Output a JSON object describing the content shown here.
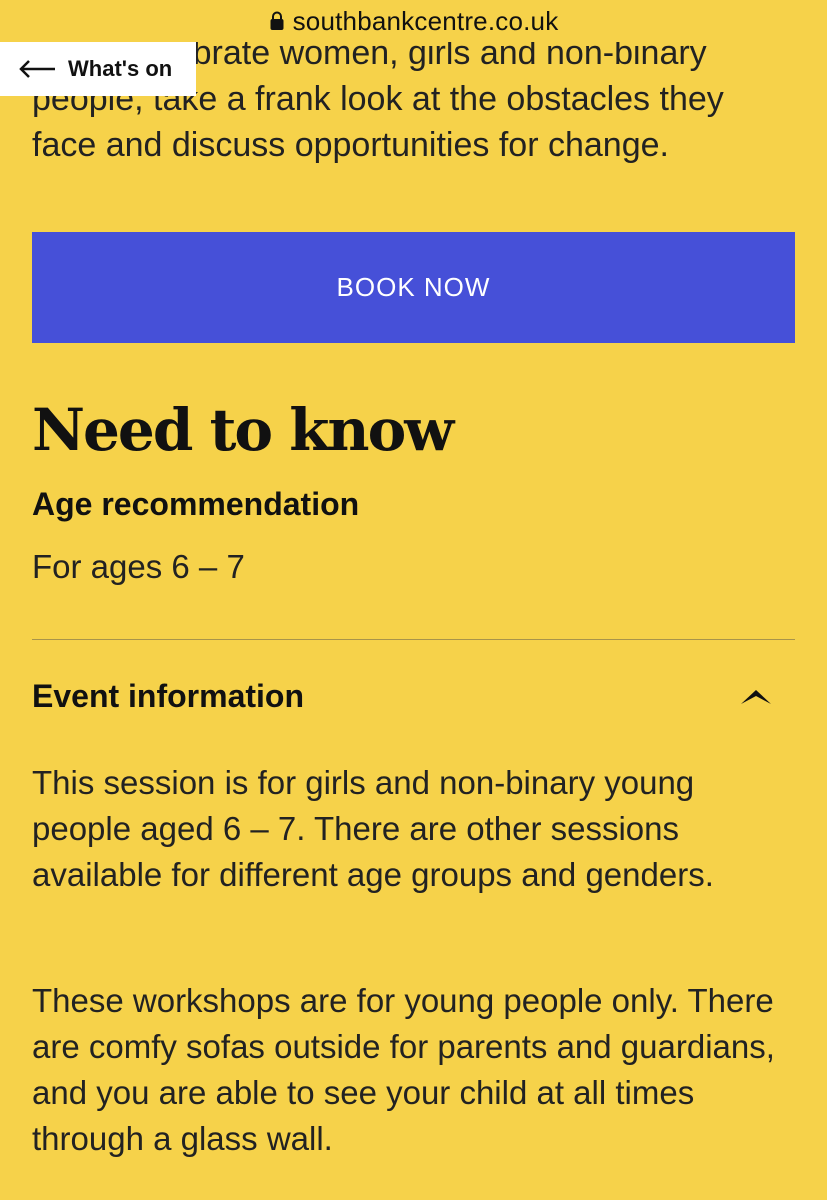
{
  "browser": {
    "url": "southbankcentre.co.uk"
  },
  "nav": {
    "back_label": "What's on"
  },
  "intro": {
    "text": "...vals celebrate women, girls and non-binary people, take a frank look at the obstacles they face and discuss opportunities for change."
  },
  "booking": {
    "button_label": "BOOK NOW"
  },
  "need_to_know": {
    "title": "Need to know",
    "age_heading": "Age recommendation",
    "age_value": "For ages 6 – 7"
  },
  "event_info": {
    "title": "Event information",
    "expanded": true,
    "paragraphs": [
      "This session is for girls and non-binary young people aged 6 – 7. There are other sessions available for different age groups and genders.",
      "These workshops are for young people only. There are comfy sofas outside for parents and guardians, and you are able to see your child at all times through a glass wall."
    ]
  },
  "colors": {
    "page_background": "#f6d24a",
    "button_background": "#4650d8",
    "button_text": "#ffffff"
  },
  "icons": {
    "lock": "lock-icon",
    "back": "back-arrow-icon",
    "collapse": "chevron-up-icon"
  }
}
